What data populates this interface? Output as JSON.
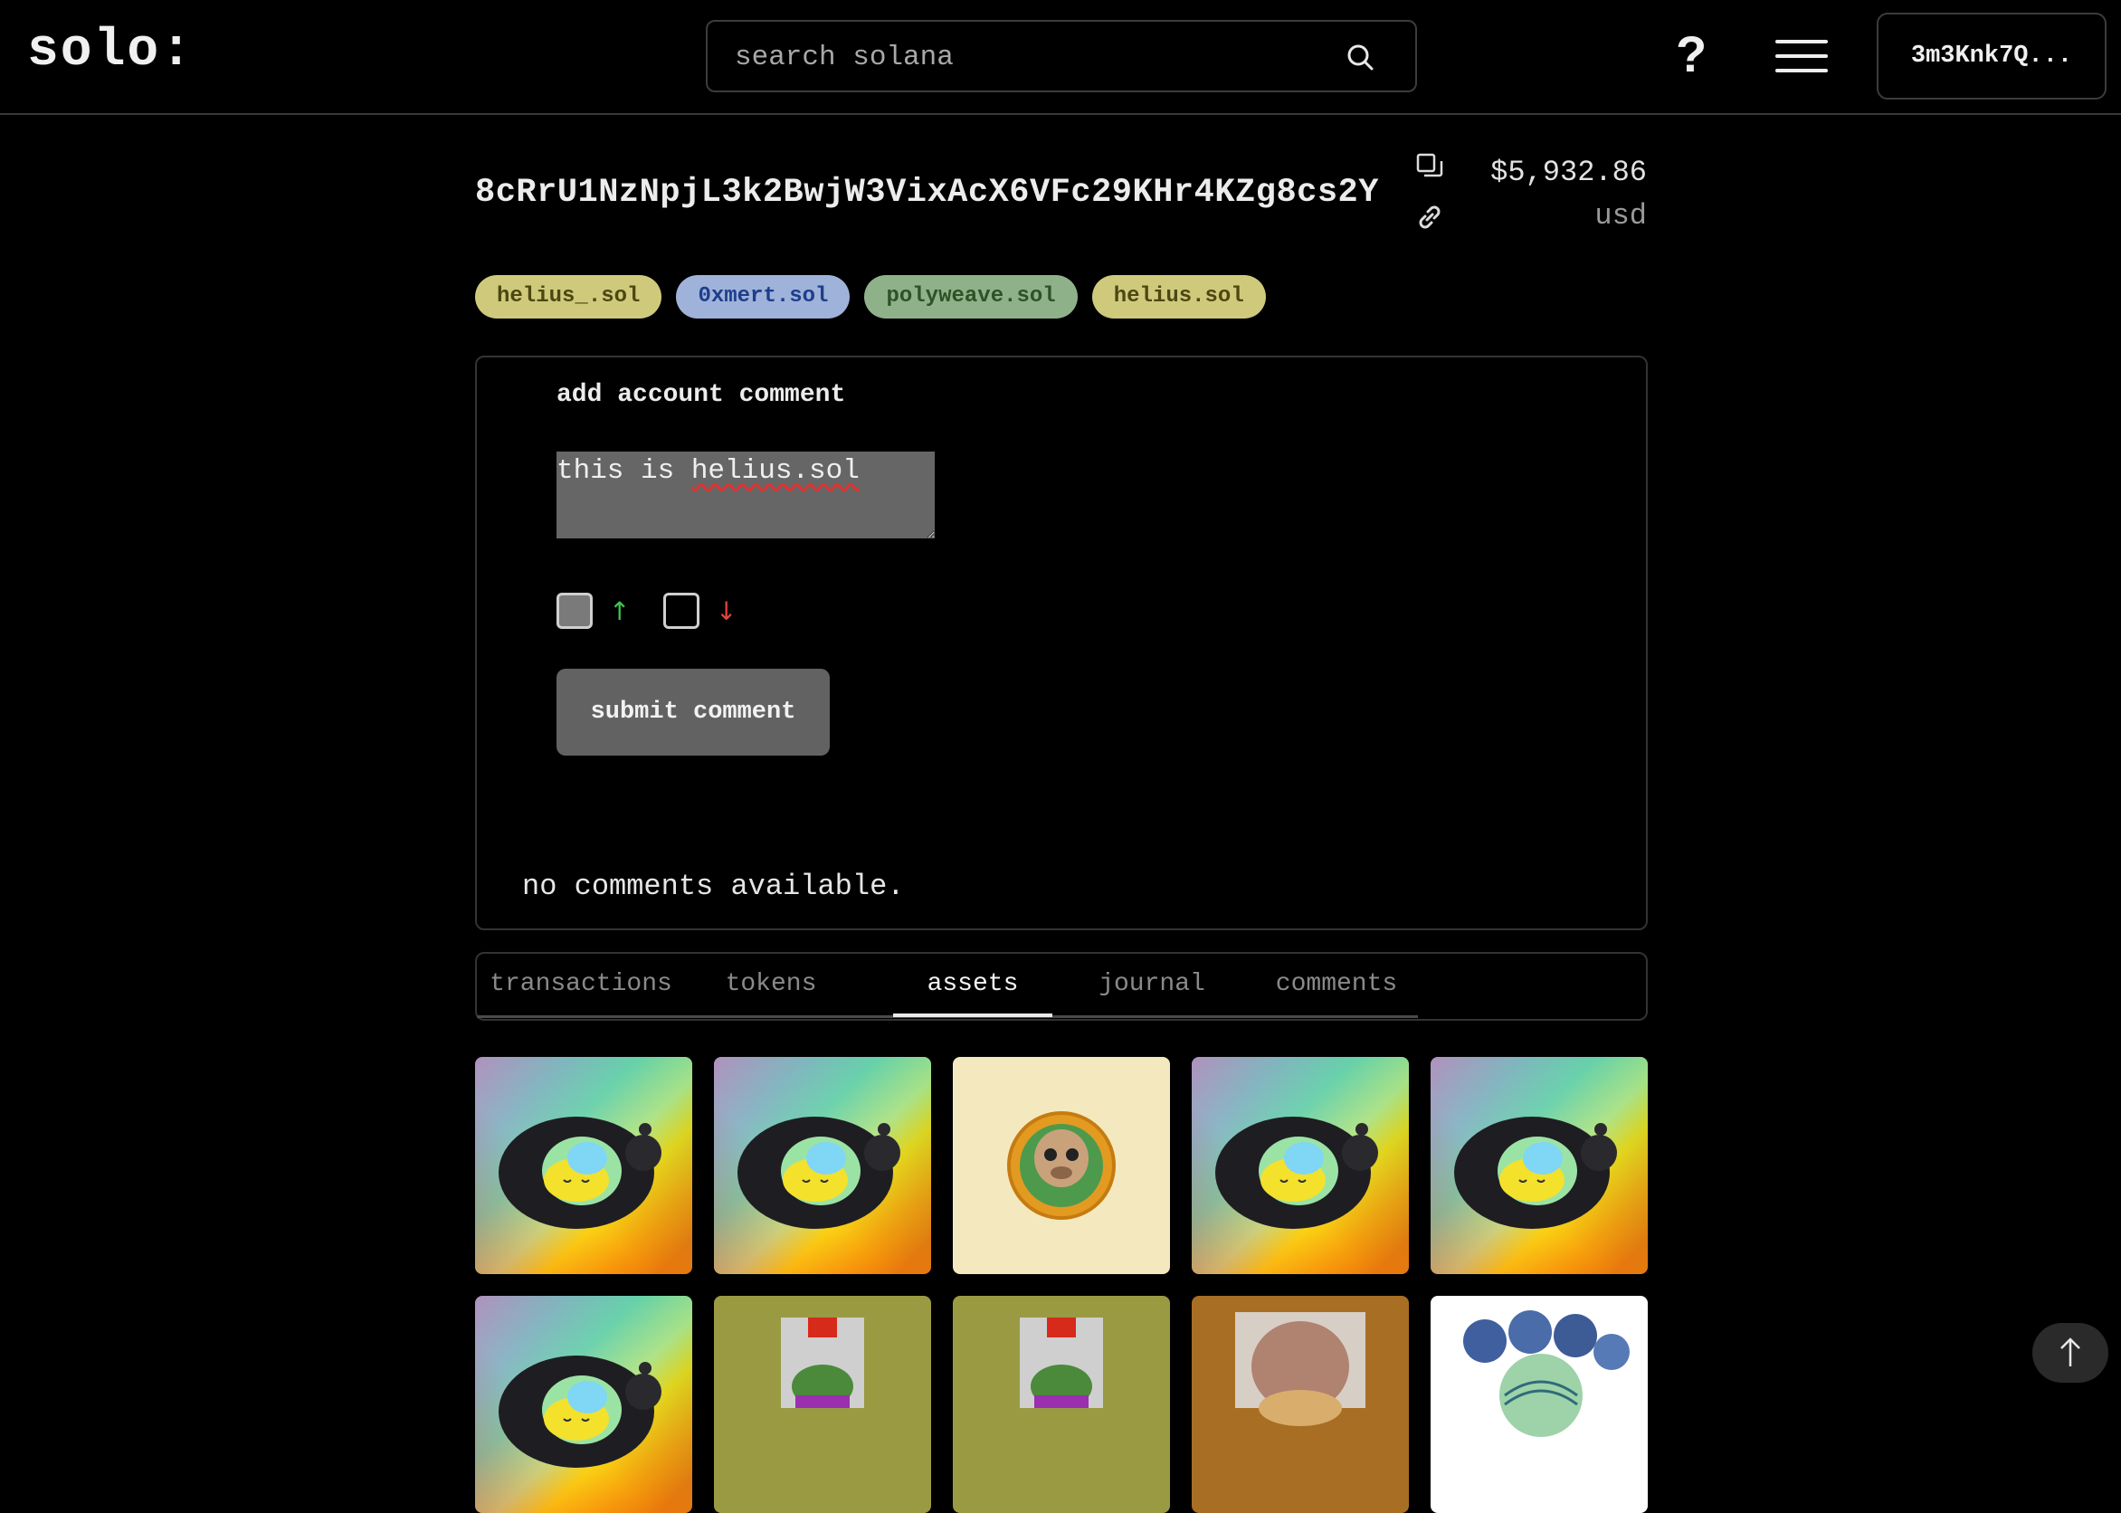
{
  "header": {
    "logo": "solo:",
    "search_placeholder": "search solana",
    "help_label": "?",
    "wallet_label": "3m3Knk7Q..."
  },
  "account": {
    "address": "8cRrU1NzNpjL3k2BwjW3VixAcX6VFc29KHr4KZg8cs2Y",
    "balance": "$5,932.86",
    "currency": "usd"
  },
  "tags": [
    {
      "label": "helius_.sol",
      "bg": "#cfca7b",
      "fg": "#4c4712"
    },
    {
      "label": "0xmert.sol",
      "bg": "#9fb2d9",
      "fg": "#1d3e8c"
    },
    {
      "label": "polyweave.sol",
      "bg": "#8fb18a",
      "fg": "#2f5127"
    },
    {
      "label": "helius.sol",
      "bg": "#cfca7b",
      "fg": "#4c4712"
    }
  ],
  "comment_panel": {
    "title": "add account comment",
    "comment_prefix": "this is ",
    "comment_highlight": "helius.sol",
    "upvote_symbol": "↑",
    "downvote_symbol": "↓",
    "upvote_color": "#3fc24f",
    "downvote_color": "#e0443b",
    "submit_label": "submit comment",
    "empty_message": "no comments available."
  },
  "tabs": [
    {
      "label": "transactions",
      "active": false
    },
    {
      "label": "tokens",
      "active": false
    },
    {
      "label": "assets",
      "active": true
    },
    {
      "label": "journal",
      "active": false
    },
    {
      "label": "comments",
      "active": false
    }
  ],
  "assets": [
    {
      "kind": "holographic-blob"
    },
    {
      "kind": "holographic-blob"
    },
    {
      "kind": "monkey-coin"
    },
    {
      "kind": "holographic-blob"
    },
    {
      "kind": "holographic-blob"
    },
    {
      "kind": "holographic-blob"
    },
    {
      "kind": "pepe-card"
    },
    {
      "kind": "pepe-card"
    },
    {
      "kind": "dog-with-hat"
    },
    {
      "kind": "cat-group"
    }
  ],
  "scroll_top_icon": "arrow-up-icon"
}
